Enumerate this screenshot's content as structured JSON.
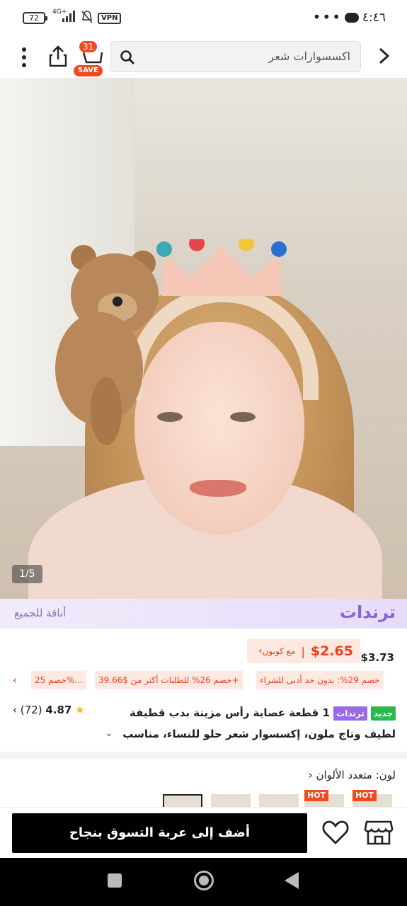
{
  "status_bar": {
    "time": "٤:٤٦",
    "more": "•••",
    "battery": "72",
    "network": "4G+",
    "vpn": "VPN"
  },
  "top_bar": {
    "search_placeholder": "اكسسوارات شعر",
    "cart_count": "31",
    "save_label": "SAVE"
  },
  "gallery": {
    "pager": "1/5"
  },
  "trend_banner": {
    "title": "ترندات",
    "tagline": "أناقة للجميع"
  },
  "price": {
    "original": "$3.73",
    "coupon_price": "$2.65",
    "coupon_label": "مع كوبون"
  },
  "discounts": [
    "خصم 29%: بدون حد أدنى للشراء",
    "خصم 26% للطلبات أكثر من $39.66+",
    "خصم 25%..."
  ],
  "product": {
    "badge_new": "جديد",
    "badge_trend": "ترندات",
    "title_line1": "1 قطعة عصابة رأس مزينة بدب قطيفة",
    "title_line2": "لطيف وتاج ملون، إكسسوار شعر حلو للنساء، مناسب",
    "rating": "4.87",
    "reviews": "(72)"
  },
  "color": {
    "label": "لون: متعدد الألوان",
    "hot_label": "HOT"
  },
  "bottom": {
    "add_to_cart": "أضف إلى عربة التسوق بنجاح"
  }
}
